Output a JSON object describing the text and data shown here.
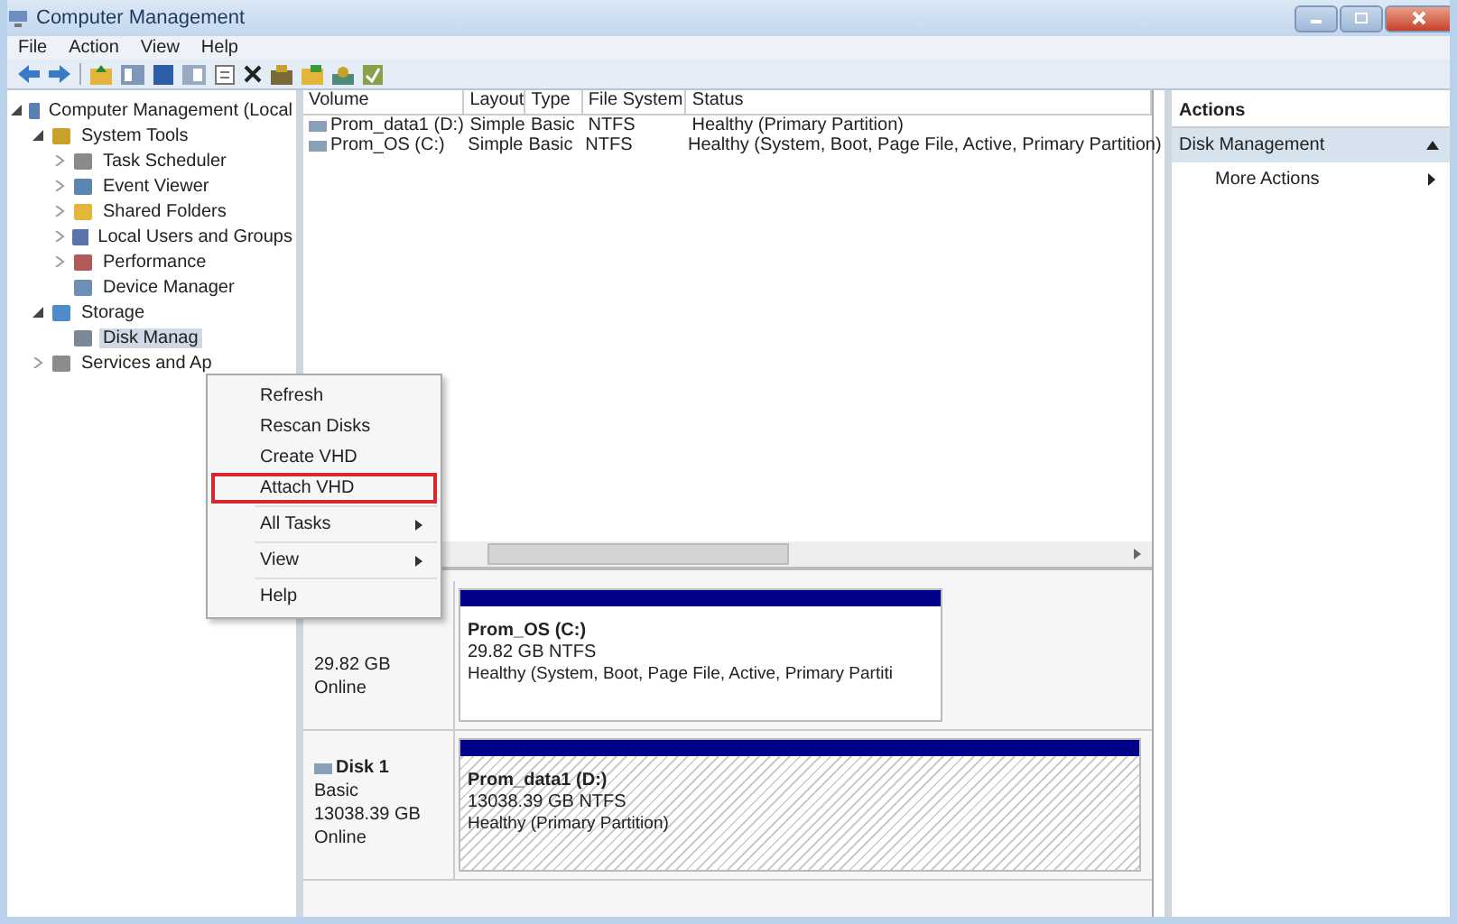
{
  "window": {
    "title": "Computer Management"
  },
  "menu": [
    "File",
    "Action",
    "View",
    "Help"
  ],
  "tree": [
    {
      "label": "Computer Management (Local",
      "expanded": true,
      "selected": false,
      "children": [
        {
          "label": "System Tools",
          "expanded": true,
          "selected": false,
          "children": [
            {
              "label": "Task Scheduler",
              "expanded": false,
              "selected": false
            },
            {
              "label": "Event Viewer",
              "expanded": false,
              "selected": false
            },
            {
              "label": "Shared Folders",
              "expanded": false,
              "selected": false
            },
            {
              "label": "Local Users and Groups",
              "expanded": false,
              "selected": false
            },
            {
              "label": "Performance",
              "expanded": false,
              "selected": false
            },
            {
              "label": "Device Manager",
              "selected": false
            }
          ]
        },
        {
          "label": "Storage",
          "expanded": true,
          "selected": false,
          "children": [
            {
              "label": "Disk Manag",
              "selected": true
            }
          ]
        },
        {
          "label": "Services and Ap",
          "expanded": false,
          "selected": false
        }
      ]
    }
  ],
  "volumes": {
    "columns": [
      "Volume",
      "Layout",
      "Type",
      "File System",
      "Status"
    ],
    "rows": [
      [
        "Prom_data1 (D:)",
        "Simple",
        "Basic",
        "NTFS",
        "Healthy (Primary Partition)"
      ],
      [
        "Prom_OS (C:)",
        "Simple",
        "Basic",
        "NTFS",
        "Healthy (System, Boot, Page File, Active, Primary Partition)"
      ]
    ]
  },
  "disks": [
    {
      "name_lines": [
        "29.82 GB",
        "Online"
      ],
      "partition": {
        "title": "Prom_OS (C:)",
        "size": "29.82 GB NTFS",
        "status": "Healthy (System, Boot, Page File, Active, Primary Partiti",
        "kind": "plain"
      }
    },
    {
      "name": "Disk 1",
      "name_lines": [
        "Basic",
        "13038.39 GB",
        "Online"
      ],
      "partition": {
        "title": "Prom_data1 (D:)",
        "size": "13038.39 GB NTFS",
        "status": "Healthy (Primary Partition)",
        "kind": "hatched"
      }
    }
  ],
  "context_menu": [
    {
      "label": "Refresh",
      "kind": "item",
      "highlighted": false
    },
    {
      "label": "Rescan Disks",
      "kind": "item",
      "highlighted": false
    },
    {
      "label": "Create VHD",
      "kind": "item",
      "highlighted": false
    },
    {
      "label": "Attach VHD",
      "kind": "item",
      "highlighted": true
    },
    {
      "label": "All Tasks",
      "kind": "submenu",
      "highlighted": false
    },
    {
      "label": "View",
      "kind": "submenu",
      "highlighted": false
    },
    {
      "label": "Help",
      "kind": "item",
      "highlighted": false
    }
  ],
  "actions": {
    "title": "Actions",
    "section": {
      "label": "Disk Management",
      "expanded": true
    },
    "items": [
      {
        "label": "More Actions"
      }
    ]
  }
}
